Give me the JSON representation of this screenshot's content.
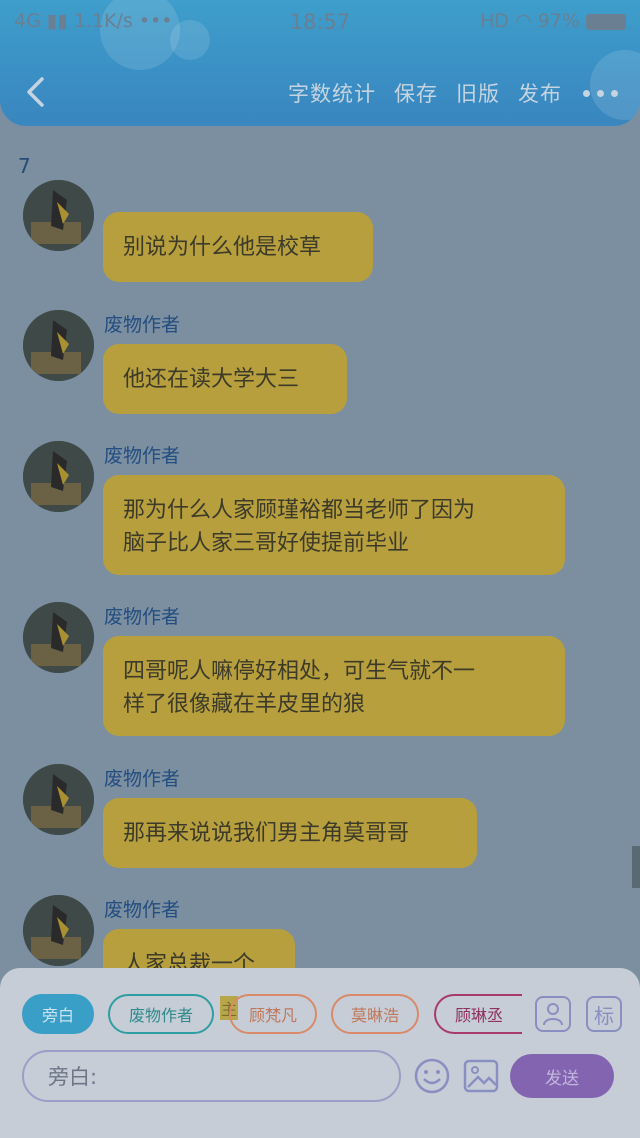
{
  "status_bar": {
    "network": "4G",
    "speed": "1.1K/s •••",
    "time": "18:57",
    "hd": "HD",
    "battery": "97%"
  },
  "nav": {
    "actions": [
      "字数统计",
      "保存",
      "旧版",
      "发布"
    ]
  },
  "chapter_number": "7",
  "messages": [
    {
      "name": "",
      "text": "别说为什么他是校草"
    },
    {
      "name": "废物作者",
      "text": "他还在读大学大三"
    },
    {
      "name": "废物作者",
      "text": "那为什么人家顾瑾裕都当老师了因为\n脑子比人家三哥好使提前毕业"
    },
    {
      "name": "废物作者",
      "text": "四哥呢人嘛停好相处，可生气就不一\n样了很像藏在羊皮里的狼"
    },
    {
      "name": "废物作者",
      "text": "那再来说说我们男主角莫哥哥"
    },
    {
      "name": "废物作者",
      "text": "人家总裁一个"
    }
  ],
  "roles": [
    {
      "label": "旁白",
      "selected": true,
      "color": "#3a9fc7"
    },
    {
      "label": "废物作者",
      "selected": false,
      "color": "#2f9ea2"
    },
    {
      "label": "主",
      "selected": false,
      "color": "#b7a74a"
    },
    {
      "label": "顾梵凡",
      "selected": false,
      "color": "#d88a6a"
    },
    {
      "label": "莫晽浩",
      "selected": false,
      "color": "#d88a6a"
    },
    {
      "label": "顾琳丞",
      "selected": false,
      "color": "#a83a6a"
    }
  ],
  "side_icons": {
    "person": "person-icon",
    "mark_label": "标"
  },
  "input": {
    "placeholder": "旁白:"
  },
  "send_label": "发送"
}
